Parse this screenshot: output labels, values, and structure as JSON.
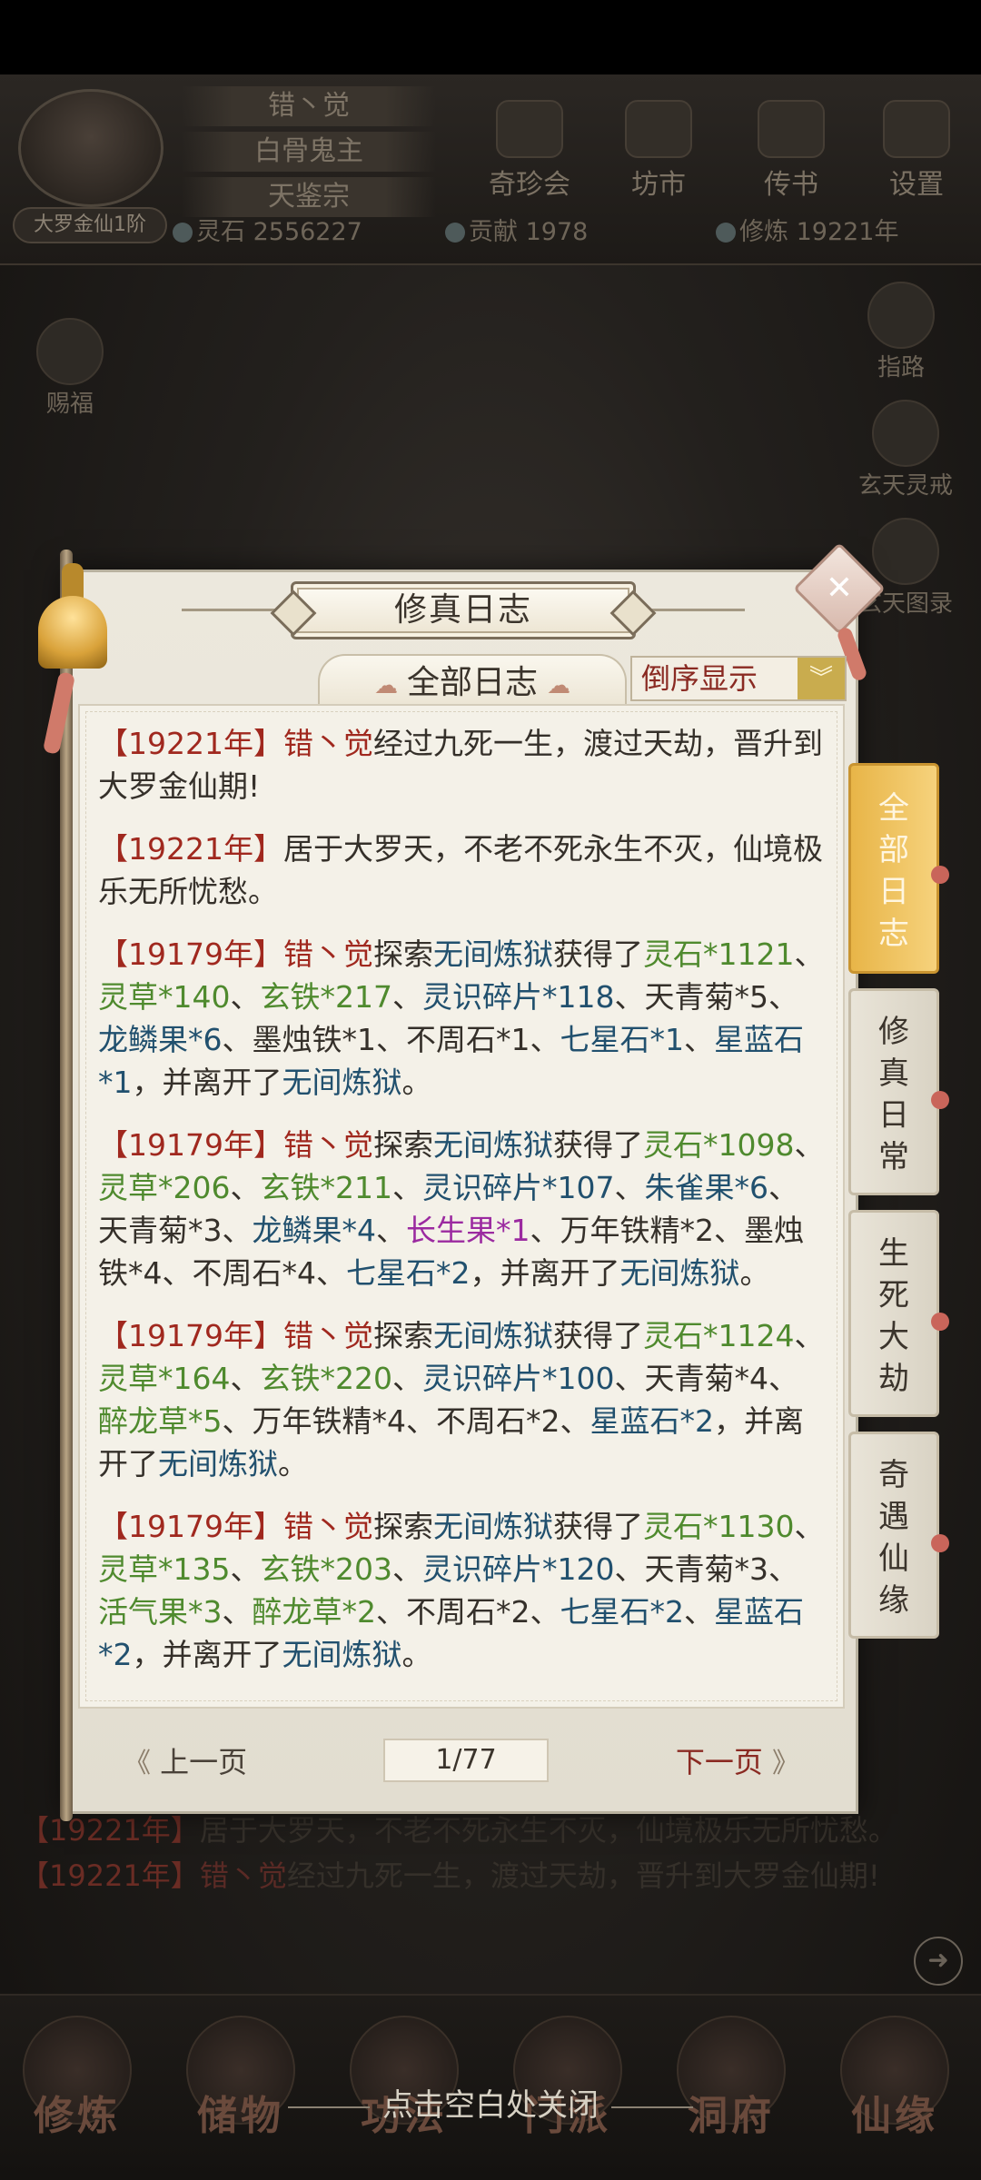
{
  "player": {
    "rank": "大罗金仙1阶",
    "name_plates": [
      "错丶觉",
      "白骨鬼主",
      "天鉴宗"
    ],
    "spirit_stone": "灵石 2556227",
    "contribution": "贡献 1978",
    "cultivation": "修炼 19221年"
  },
  "top_menu": [
    "奇珍会",
    "坊市",
    "传书",
    "设置"
  ],
  "left_buttons": [
    "赐福"
  ],
  "right_buttons": [
    "指路",
    "玄天灵戒",
    "玄天图录"
  ],
  "modal": {
    "title": "修真日志",
    "filter_label": "全部日志",
    "sort_label": "倒序显示",
    "side_tabs": [
      "全部日志",
      "修真日常",
      "生死大劫",
      "奇遇仙缘"
    ],
    "entries": [
      [
        {
          "t": "【19221年】",
          "c": "year"
        },
        {
          "t": "错丶觉",
          "c": "name"
        },
        {
          "t": "经过九死一生，渡过天劫，晋升到大罗金仙期!",
          "c": "plain"
        }
      ],
      [
        {
          "t": "【19221年】",
          "c": "year"
        },
        {
          "t": "居于大罗天，不老不死永生不灭，仙境极乐无所忧愁。",
          "c": "plain"
        }
      ],
      [
        {
          "t": "【19179年】",
          "c": "year"
        },
        {
          "t": "错丶觉",
          "c": "name"
        },
        {
          "t": "探索",
          "c": "plain"
        },
        {
          "t": "无间炼狱",
          "c": "place"
        },
        {
          "t": "获得了",
          "c": "plain"
        },
        {
          "t": "灵石*1121",
          "c": "green"
        },
        {
          "t": "、",
          "c": "plain"
        },
        {
          "t": "灵草*140",
          "c": "green"
        },
        {
          "t": "、",
          "c": "plain"
        },
        {
          "t": "玄铁*217",
          "c": "green"
        },
        {
          "t": "、",
          "c": "plain"
        },
        {
          "t": "灵识碎片*118",
          "c": "blue"
        },
        {
          "t": "、天青菊*5、",
          "c": "plain"
        },
        {
          "t": "龙鳞果*6",
          "c": "blue"
        },
        {
          "t": "、墨烛铁*1、不周石*1、",
          "c": "plain"
        },
        {
          "t": "七星石*1",
          "c": "blue"
        },
        {
          "t": "、",
          "c": "plain"
        },
        {
          "t": "星蓝石*1",
          "c": "blue"
        },
        {
          "t": "，并离开了",
          "c": "plain"
        },
        {
          "t": "无间炼狱",
          "c": "place"
        },
        {
          "t": "。",
          "c": "plain"
        }
      ],
      [
        {
          "t": "【19179年】",
          "c": "year"
        },
        {
          "t": "错丶觉",
          "c": "name"
        },
        {
          "t": "探索",
          "c": "plain"
        },
        {
          "t": "无间炼狱",
          "c": "place"
        },
        {
          "t": "获得了",
          "c": "plain"
        },
        {
          "t": "灵石*1098",
          "c": "green"
        },
        {
          "t": "、",
          "c": "plain"
        },
        {
          "t": "灵草*206",
          "c": "green"
        },
        {
          "t": "、",
          "c": "plain"
        },
        {
          "t": "玄铁*211",
          "c": "green"
        },
        {
          "t": "、",
          "c": "plain"
        },
        {
          "t": "灵识碎片*107",
          "c": "blue"
        },
        {
          "t": "、",
          "c": "plain"
        },
        {
          "t": "朱雀果*6",
          "c": "blue"
        },
        {
          "t": "、天青菊*3、",
          "c": "plain"
        },
        {
          "t": "龙鳞果*4",
          "c": "blue"
        },
        {
          "t": "、",
          "c": "plain"
        },
        {
          "t": "长生果*1",
          "c": "purple"
        },
        {
          "t": "、万年铁精*2、墨烛铁*4、不周石*4、",
          "c": "plain"
        },
        {
          "t": "七星石*2",
          "c": "blue"
        },
        {
          "t": "，并离开了",
          "c": "plain"
        },
        {
          "t": "无间炼狱",
          "c": "place"
        },
        {
          "t": "。",
          "c": "plain"
        }
      ],
      [
        {
          "t": "【19179年】",
          "c": "year"
        },
        {
          "t": "错丶觉",
          "c": "name"
        },
        {
          "t": "探索",
          "c": "plain"
        },
        {
          "t": "无间炼狱",
          "c": "place"
        },
        {
          "t": "获得了",
          "c": "plain"
        },
        {
          "t": "灵石*1124",
          "c": "green"
        },
        {
          "t": "、",
          "c": "plain"
        },
        {
          "t": "灵草*164",
          "c": "green"
        },
        {
          "t": "、",
          "c": "plain"
        },
        {
          "t": "玄铁*220",
          "c": "green"
        },
        {
          "t": "、",
          "c": "plain"
        },
        {
          "t": "灵识碎片*100",
          "c": "blue"
        },
        {
          "t": "、天青菊*4、",
          "c": "plain"
        },
        {
          "t": "醉龙草*5",
          "c": "green"
        },
        {
          "t": "、万年铁精*4、不周石*2、",
          "c": "plain"
        },
        {
          "t": "星蓝石*2",
          "c": "blue"
        },
        {
          "t": "，并离开了",
          "c": "plain"
        },
        {
          "t": "无间炼狱",
          "c": "place"
        },
        {
          "t": "。",
          "c": "plain"
        }
      ],
      [
        {
          "t": "【19179年】",
          "c": "year"
        },
        {
          "t": "错丶觉",
          "c": "name"
        },
        {
          "t": "探索",
          "c": "plain"
        },
        {
          "t": "无间炼狱",
          "c": "place"
        },
        {
          "t": "获得了",
          "c": "plain"
        },
        {
          "t": "灵石*1130",
          "c": "green"
        },
        {
          "t": "、",
          "c": "plain"
        },
        {
          "t": "灵草*135",
          "c": "green"
        },
        {
          "t": "、",
          "c": "plain"
        },
        {
          "t": "玄铁*203",
          "c": "green"
        },
        {
          "t": "、",
          "c": "plain"
        },
        {
          "t": "灵识碎片*120",
          "c": "blue"
        },
        {
          "t": "、天青菊*3、",
          "c": "plain"
        },
        {
          "t": "活气果*3",
          "c": "green"
        },
        {
          "t": "、",
          "c": "plain"
        },
        {
          "t": "醉龙草*2",
          "c": "green"
        },
        {
          "t": "、不周石*2、",
          "c": "plain"
        },
        {
          "t": "七星石*2",
          "c": "blue"
        },
        {
          "t": "、",
          "c": "plain"
        },
        {
          "t": "星蓝石*2",
          "c": "blue"
        },
        {
          "t": "，并离开了",
          "c": "plain"
        },
        {
          "t": "无间炼狱",
          "c": "place"
        },
        {
          "t": "。",
          "c": "plain"
        }
      ]
    ],
    "pager": {
      "prev": "上一页",
      "page": "1/77",
      "next": "下一页"
    }
  },
  "background_log": [
    [
      {
        "t": "【19221年】",
        "c": "year"
      },
      {
        "t": "居于大罗天，不老不死永生不灭，仙境极乐无所忧愁。",
        "c": "plain"
      }
    ],
    [
      {
        "t": "【19221年】",
        "c": "year"
      },
      {
        "t": "错丶觉",
        "c": "name"
      },
      {
        "t": "经过九死一生，渡过天劫，晋升到大罗金仙期!",
        "c": "plain"
      }
    ]
  ],
  "bottom_nav": [
    "修炼",
    "储物",
    "功法",
    "门派",
    "洞府",
    "仙缘"
  ],
  "close_hint": "点击空白处关闭",
  "colors": {
    "year": "#a0281e",
    "name": "#a0281e",
    "place": "#21506e",
    "item_green": "#4f8a2e",
    "item_blue": "#21506e",
    "item_purple": "#9b2aa0",
    "active_tab": "#e8b548"
  }
}
